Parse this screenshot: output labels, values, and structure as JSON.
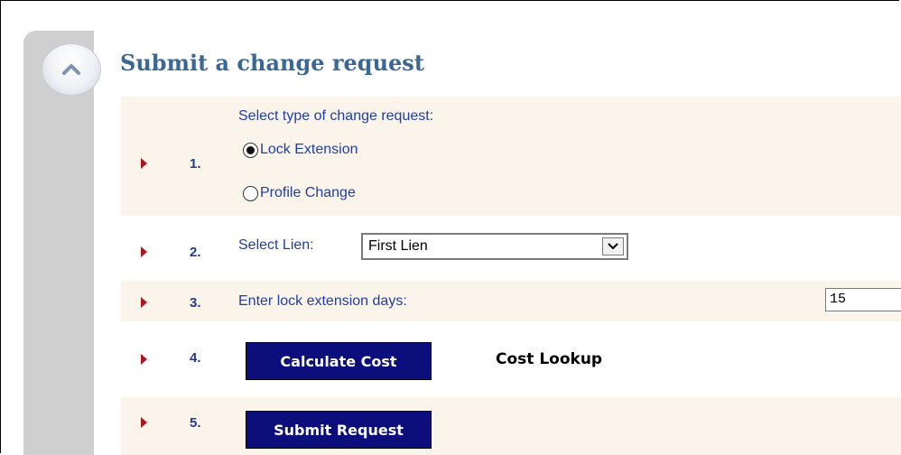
{
  "panel": {
    "title": "Submit a change request",
    "collapse_icon": "chevron-up-icon"
  },
  "steps": [
    {
      "number": "1.",
      "label": "Select type of change request:",
      "options": [
        {
          "label": "Lock Extension",
          "selected": true
        },
        {
          "label": "Profile Change",
          "selected": false
        }
      ]
    },
    {
      "number": "2.",
      "label": "Select Lien:",
      "select_value": "First Lien"
    },
    {
      "number": "3.",
      "label": "Enter lock extension days:",
      "input_value": "15"
    },
    {
      "number": "4.",
      "button_label": "Calculate Cost",
      "link_label": "Cost Lookup"
    },
    {
      "number": "5.",
      "button_label": "Submit Request"
    }
  ],
  "colors": {
    "title": "#3a6796",
    "step_number": "#1f3b8f",
    "arrow": "#a8191d",
    "button_bg": "#0c0e7c",
    "shaded_row": "#fbf4ea"
  }
}
